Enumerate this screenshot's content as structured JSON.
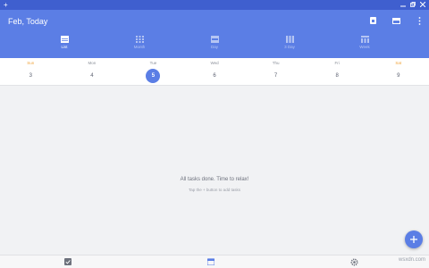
{
  "titlebar": {
    "left_glyph": "+"
  },
  "appbar": {
    "title": "Feb, Today",
    "actions": [
      "calendar-day-icon",
      "view-icon",
      "more-vert-icon"
    ]
  },
  "tabs": [
    {
      "label": "List",
      "icon": "list-icon",
      "active": true
    },
    {
      "label": "Month",
      "icon": "month-grid-icon",
      "active": false
    },
    {
      "label": "Day",
      "icon": "day-icon",
      "active": false
    },
    {
      "label": "3 Day",
      "icon": "three-day-icon",
      "active": false
    },
    {
      "label": "Week",
      "icon": "week-icon",
      "active": false
    }
  ],
  "week": {
    "days": [
      {
        "name": "Sun",
        "num": "3"
      },
      {
        "name": "Mon",
        "num": "4"
      },
      {
        "name": "Tue",
        "num": "5"
      },
      {
        "name": "Wed",
        "num": "6"
      },
      {
        "name": "Thu",
        "num": "7"
      },
      {
        "name": "Fri",
        "num": "8"
      },
      {
        "name": "Sat",
        "num": "9"
      }
    ]
  },
  "empty_state": {
    "message": "All tasks done. Time to relax!",
    "hint": "Tap the + button to add tasks"
  },
  "fab": {
    "label": "+"
  },
  "bottom_nav": [
    "tasks-icon",
    "calendar-icon",
    "settings-icon"
  ],
  "watermark": "wsxdn.com",
  "colors": {
    "accent": "#5b7ee5",
    "titlebar": "#3f5fcf",
    "weekend": "#f0a33a"
  }
}
